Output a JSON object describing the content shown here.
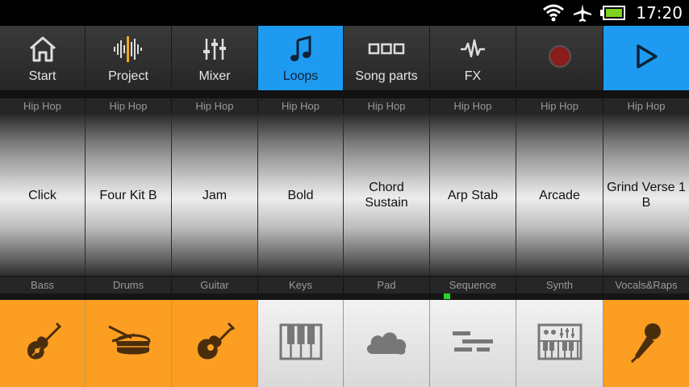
{
  "status_bar": {
    "time": "17:20",
    "icons": [
      "wifi-icon",
      "airplane-icon",
      "battery-icon"
    ]
  },
  "toolbar": {
    "buttons": [
      {
        "label": "Start",
        "icon": "home-icon",
        "active": false
      },
      {
        "label": "Project",
        "icon": "waveform-icon",
        "active": false
      },
      {
        "label": "Mixer",
        "icon": "mixer-sliders-icon",
        "active": false
      },
      {
        "label": "Loops",
        "icon": "music-note-icon",
        "active": true
      },
      {
        "label": "Song parts",
        "icon": "song-parts-icon",
        "active": false
      },
      {
        "label": "FX",
        "icon": "fx-wave-icon",
        "active": false
      }
    ],
    "record_icon": "record-icon",
    "play_icon": "play-icon",
    "colors": {
      "active": "#1e9bf0",
      "record": "#8a1c1c"
    }
  },
  "loops": [
    {
      "genre": "Hip Hop",
      "name": "Click"
    },
    {
      "genre": "Hip Hop",
      "name": "Four Kit B"
    },
    {
      "genre": "Hip Hop",
      "name": "Jam"
    },
    {
      "genre": "Hip Hop",
      "name": "Bold"
    },
    {
      "genre": "Hip Hop",
      "name": "Chord Sustain"
    },
    {
      "genre": "Hip Hop",
      "name": "Arp Stab"
    },
    {
      "genre": "Hip Hop",
      "name": "Arcade"
    },
    {
      "genre": "Hip Hop",
      "name": "Grind Verse 1 B"
    }
  ],
  "instruments": [
    {
      "category": "Bass",
      "icon": "bass-guitar-icon",
      "active": true
    },
    {
      "category": "Drums",
      "icon": "drum-icon",
      "active": true
    },
    {
      "category": "Guitar",
      "icon": "acoustic-guitar-icon",
      "active": true
    },
    {
      "category": "Keys",
      "icon": "piano-keys-icon",
      "active": false
    },
    {
      "category": "Pad",
      "icon": "cloud-pad-icon",
      "active": false
    },
    {
      "category": "Sequence",
      "icon": "sequence-icon",
      "active": false
    },
    {
      "category": "Synth",
      "icon": "synth-icon",
      "active": false
    },
    {
      "category": "Vocals&Raps",
      "icon": "microphone-icon",
      "active": true
    }
  ],
  "colors": {
    "instrument_on": "#fc9e22",
    "level_indicator": "#27d427"
  }
}
